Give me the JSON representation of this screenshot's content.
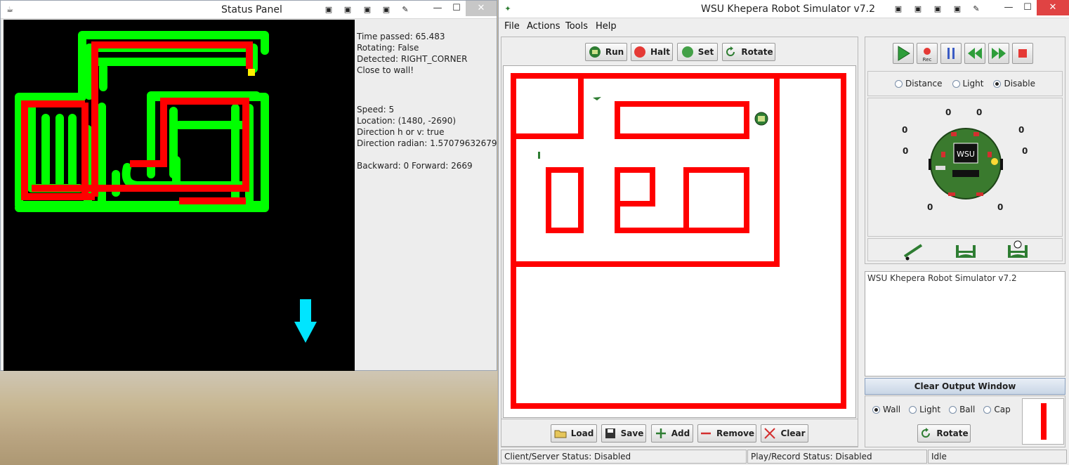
{
  "status_window": {
    "title": "Status Panel",
    "lines_group1": [
      "Time passed: 65.483",
      "Rotating: False",
      "Detected: RIGHT_CORNER",
      "Close to wall!"
    ],
    "lines_group2": [
      "Speed: 5",
      "Location: (1480, -2690)",
      "Direction h or v: true",
      "Direction radian: 1.57079632679..."
    ],
    "lines_group3": [
      "Backward: 0 Forward: 2669"
    ],
    "arrow_direction": "down",
    "arrow_color": "#00e5ff"
  },
  "sim_window": {
    "title": "WSU Khepera Robot Simulator v7.2",
    "menu": [
      "File",
      "Actions",
      "Tools",
      "Help"
    ],
    "toolbar": {
      "run": "Run",
      "halt": "Halt",
      "set": "Set",
      "rotate": "Rotate"
    },
    "bottom_toolbar": {
      "load": "Load",
      "save": "Save",
      "add": "Add",
      "remove": "Remove",
      "clear": "Clear"
    },
    "sensor_mode": {
      "distance": "Distance",
      "light": "Light",
      "disable": "Disable",
      "selected": "Disable"
    },
    "robot_label": "WSU",
    "sensor_values": [
      "0",
      "0",
      "0",
      "0",
      "0",
      "0",
      "0",
      "0"
    ],
    "output_text": "WSU Khepera Robot Simulator v7.2",
    "clear_output_label": "Clear Output Window",
    "object_types": {
      "wall": "Wall",
      "light": "Light",
      "ball": "Ball",
      "cap": "Cap",
      "selected": "Wall"
    },
    "rotate_label": "Rotate",
    "status": {
      "client_server": "Client/Server Status: Disabled",
      "play_record": "Play/Record Status: Disabled",
      "state": "Idle"
    },
    "colors": {
      "wall": "#ff0000",
      "robot": "#2e7d32",
      "accent": "#c7d4e6"
    }
  }
}
